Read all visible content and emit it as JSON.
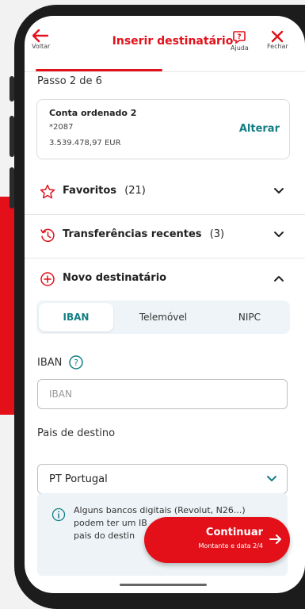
{
  "header": {
    "back_label": "Voltar",
    "title": "Inserir destinatário",
    "help_label": "Ajuda",
    "close_label": "Fechar"
  },
  "step_text": "Passo 2 de 6",
  "account": {
    "name": "Conta ordenado 2",
    "number": "*2087",
    "balance": "3.539.478,97 EUR",
    "change_label": "Alterar"
  },
  "sections": {
    "favorites": {
      "label": "Favoritos",
      "count": "(21)"
    },
    "recent": {
      "label": "Transferências recentes",
      "count": "(3)"
    },
    "new_recipient": {
      "label": "Novo destinatário"
    }
  },
  "tabs": [
    {
      "label": "IBAN",
      "active": true
    },
    {
      "label": "Telemóvel",
      "active": false
    },
    {
      "label": "NIPC",
      "active": false
    }
  ],
  "iban": {
    "label": "IBAN",
    "placeholder": "IBAN",
    "value": ""
  },
  "country": {
    "label": "Pais de destino",
    "value": "PT Portugal"
  },
  "info": {
    "text_line1": "Alguns bancos digitais (Revolut, N26...)",
    "text_line2": "podem ter um IB",
    "text_line3": "pais do destin"
  },
  "cta": {
    "label": "Continuar",
    "sublabel": "Montante e data 2/4"
  },
  "colors": {
    "brand_red": "#e3101a",
    "teal": "#137e84"
  },
  "icons": {
    "back": "arrow-left-icon",
    "help": "help-bubble-icon",
    "close": "close-icon",
    "favorites": "star-icon",
    "recent": "clock-icon",
    "new": "plus-circle-icon",
    "info": "info-icon"
  }
}
